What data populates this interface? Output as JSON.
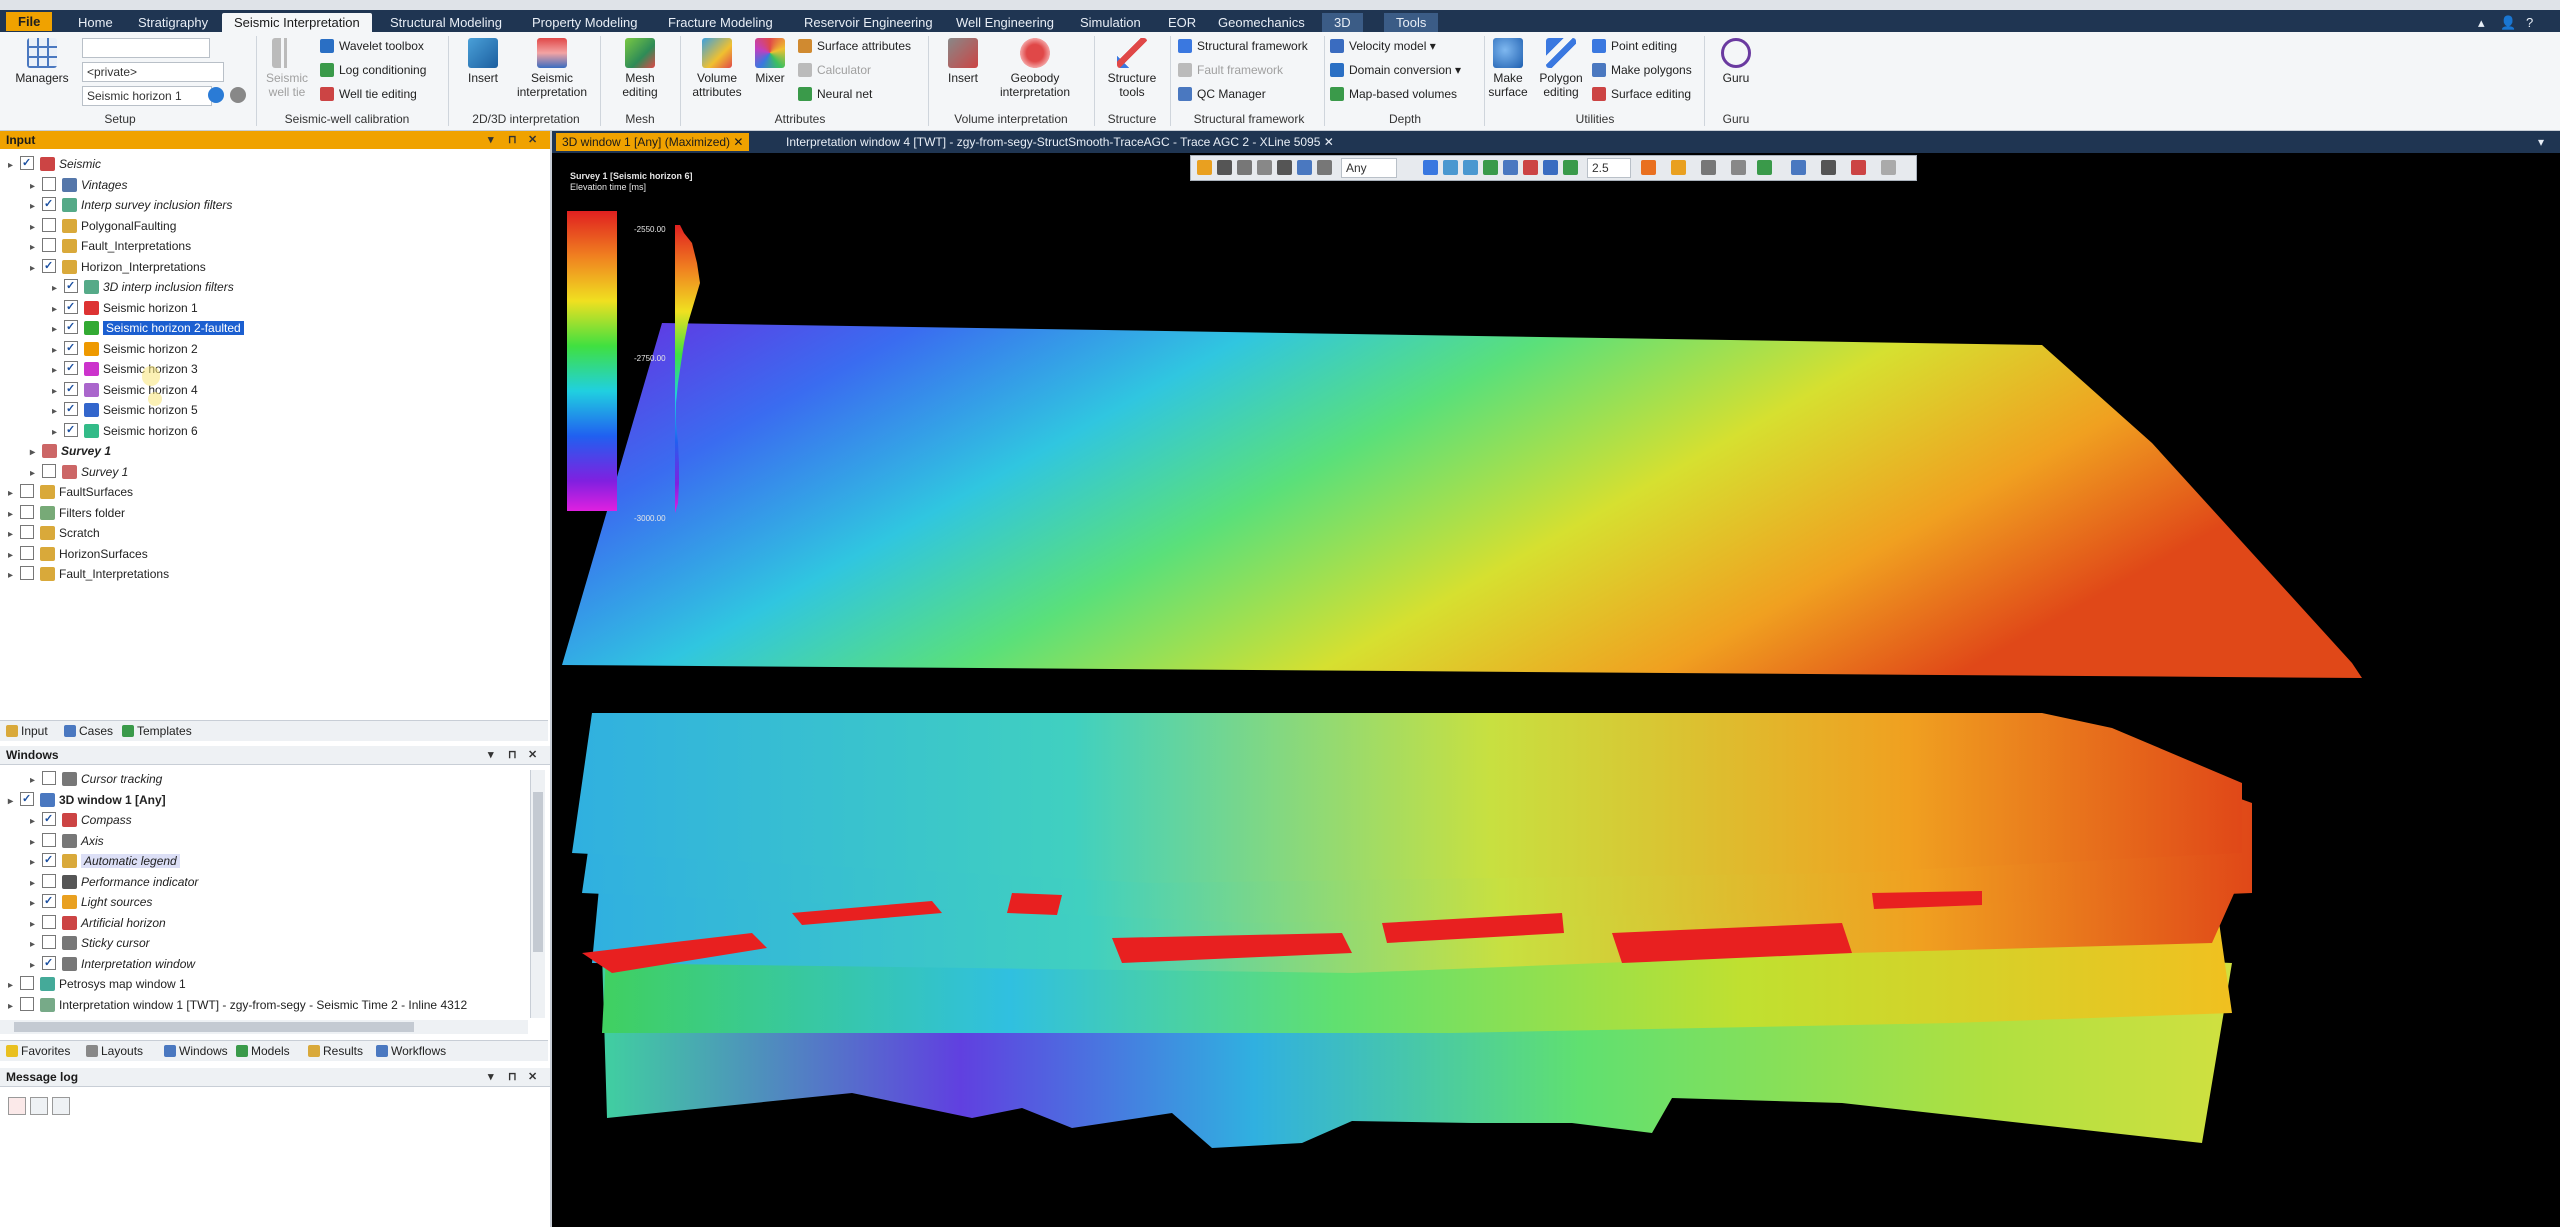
{
  "ribbon_tabs": [
    "File",
    "Home",
    "Stratigraphy",
    "Seismic Interpretation",
    "Structural Modeling",
    "Property Modeling",
    "Fracture Modeling",
    "Reservoir Engineering",
    "Well Engineering",
    "Simulation",
    "EOR",
    "Geomechanics",
    "3D",
    "Tools"
  ],
  "ribbon": {
    "setup": {
      "managers": "Managers",
      "private_combo": "<private>",
      "horizon_combo": "Seismic horizon 1",
      "label": "Setup"
    },
    "well_cal": {
      "seismic_well_tie": "Seismic well tie",
      "wavelet": "Wavelet toolbox",
      "log_cond": "Log conditioning",
      "well_tie_edit": "Well tie editing",
      "label": "Seismic-well calibration"
    },
    "interp2d3d": {
      "insert": "Insert",
      "seismic_interp": "Seismic interpretation",
      "label": "2D/3D interpretation"
    },
    "mesh": {
      "mesh_editing": "Mesh editing",
      "label": "Mesh"
    },
    "attributes": {
      "volume_attr": "Volume attributes",
      "mixer": "Mixer",
      "surface_attr": "Surface attributes",
      "calculator": "Calculator",
      "neural_net": "Neural net",
      "label": "Attributes"
    },
    "vol_interp": {
      "insert": "Insert",
      "geobody": "Geobody interpretation",
      "label": "Volume interpretation"
    },
    "structure": {
      "structure_tools": "Structure tools",
      "label": "Structure"
    },
    "struct_fw": {
      "structural_framework": "Structural framework",
      "fault_framework": "Fault framework",
      "qc_manager": "QC Manager",
      "label": "Structural framework"
    },
    "depth": {
      "velocity_model": "Velocity model",
      "domain_conversion": "Domain conversion",
      "map_based": "Map-based volumes",
      "label": "Depth"
    },
    "utilities": {
      "make_surface": "Make surface",
      "polygon_editing": "Polygon editing",
      "point_editing": "Point editing",
      "make_polygons": "Make polygons",
      "surface_editing": "Surface editing",
      "label": "Utilities"
    },
    "guru": {
      "guru": "Guru",
      "label": "Guru"
    }
  },
  "input_panel": {
    "title": "Input",
    "tree": [
      {
        "label": "Seismic",
        "indent": 0,
        "checked": true,
        "italic": true,
        "icon": "seismic-icon",
        "color": "#c44"
      },
      {
        "label": "Vintages",
        "indent": 1,
        "checked": false,
        "italic": true,
        "icon": "vintage-icon",
        "color": "#57a"
      },
      {
        "label": "Interp survey inclusion filters",
        "indent": 1,
        "checked": true,
        "italic": true,
        "icon": "filter-icon",
        "color": "#5a8"
      },
      {
        "label": "PolygonalFaulting",
        "indent": 1,
        "checked": false,
        "italic": false,
        "icon": "folder-icon",
        "color": "#d9a93a"
      },
      {
        "label": "Fault_Interpretations",
        "indent": 1,
        "checked": false,
        "italic": false,
        "icon": "folder-icon",
        "color": "#d9a93a"
      },
      {
        "label": "Horizon_Interpretations",
        "indent": 1,
        "checked": true,
        "italic": false,
        "icon": "folder-icon",
        "color": "#d9a93a"
      },
      {
        "label": "3D interp inclusion filters",
        "indent": 2,
        "checked": true,
        "italic": true,
        "icon": "filter-icon",
        "color": "#5a8"
      },
      {
        "label": "Seismic horizon 1",
        "indent": 2,
        "checked": true,
        "italic": false,
        "icon": "horizon-icon",
        "color": "#d33"
      },
      {
        "label": "Seismic horizon 2-faulted",
        "indent": 2,
        "checked": true,
        "italic": false,
        "icon": "horizon-icon",
        "color": "#3a3",
        "selected": true
      },
      {
        "label": "Seismic horizon 2",
        "indent": 2,
        "checked": true,
        "italic": false,
        "icon": "horizon-icon",
        "color": "#e90"
      },
      {
        "label": "Seismic horizon 3",
        "indent": 2,
        "checked": true,
        "italic": false,
        "icon": "horizon-icon",
        "color": "#c3c"
      },
      {
        "label": "Seismic horizon 4",
        "indent": 2,
        "checked": true,
        "italic": false,
        "icon": "horizon-icon",
        "color": "#a6c"
      },
      {
        "label": "Seismic horizon 5",
        "indent": 2,
        "checked": true,
        "italic": false,
        "icon": "horizon-icon",
        "color": "#36c"
      },
      {
        "label": "Seismic horizon 6",
        "indent": 2,
        "checked": true,
        "italic": false,
        "icon": "horizon-icon",
        "color": "#3b8"
      },
      {
        "label": "Survey 1",
        "indent": 1,
        "checked": null,
        "italic": true,
        "bold": true,
        "icon": "survey-icon",
        "color": "#c66"
      },
      {
        "label": "Survey 1",
        "indent": 1,
        "checked": false,
        "italic": true,
        "icon": "survey-icon",
        "color": "#c66"
      },
      {
        "label": "FaultSurfaces",
        "indent": 0,
        "checked": false,
        "italic": false,
        "icon": "folder-icon",
        "color": "#d9a93a"
      },
      {
        "label": "Filters folder",
        "indent": 0,
        "checked": false,
        "italic": false,
        "icon": "folder-icon",
        "color": "#7a7"
      },
      {
        "label": "Scratch",
        "indent": 0,
        "checked": false,
        "italic": false,
        "icon": "folder-icon",
        "color": "#d9a93a"
      },
      {
        "label": "HorizonSurfaces",
        "indent": 0,
        "checked": false,
        "italic": false,
        "icon": "folder-icon",
        "color": "#d9a93a"
      },
      {
        "label": "Fault_Interpretations",
        "indent": 0,
        "checked": false,
        "italic": false,
        "icon": "folder-icon",
        "color": "#d9a93a"
      }
    ],
    "tabs": [
      "Input",
      "Cases",
      "Templates"
    ]
  },
  "windows_panel": {
    "title": "Windows",
    "tree": [
      {
        "label": "Cursor tracking",
        "indent": 1,
        "checked": false,
        "italic": true,
        "icon": "cursor-icon",
        "color": "#777"
      },
      {
        "label": "3D window 1 [Any]",
        "indent": 0,
        "checked": true,
        "italic": false,
        "bold": true,
        "icon": "window3d-icon",
        "color": "#4a78c0"
      },
      {
        "label": "Compass",
        "indent": 1,
        "checked": true,
        "italic": true,
        "icon": "compass-icon",
        "color": "#c44"
      },
      {
        "label": "Axis",
        "indent": 1,
        "checked": false,
        "italic": true,
        "icon": "axis-icon",
        "color": "#777"
      },
      {
        "label": "Automatic legend",
        "indent": 1,
        "checked": true,
        "italic": true,
        "icon": "legend-icon",
        "color": "#d9a93a",
        "highlight": true
      },
      {
        "label": "Performance indicator",
        "indent": 1,
        "checked": false,
        "italic": true,
        "icon": "performance-icon",
        "color": "#555"
      },
      {
        "label": "Light sources",
        "indent": 1,
        "checked": true,
        "italic": true,
        "icon": "light-icon",
        "color": "#e9a020"
      },
      {
        "label": "Artificial horizon",
        "indent": 1,
        "checked": false,
        "italic": true,
        "icon": "horizon-ring-icon",
        "color": "#c44"
      },
      {
        "label": "Sticky cursor",
        "indent": 1,
        "checked": false,
        "italic": true,
        "icon": "cursor-icon",
        "color": "#777"
      },
      {
        "label": "Interpretation window",
        "indent": 1,
        "checked": true,
        "italic": true,
        "icon": "interp-window-icon",
        "color": "#777"
      },
      {
        "label": "Petrosys map window 1",
        "indent": 0,
        "checked": false,
        "italic": false,
        "icon": "map-window-icon",
        "color": "#4a9"
      },
      {
        "label": "Interpretation window 1 [TWT] - zgy-from-segy - Seismic Time 2 - Inline 4312",
        "indent": 0,
        "checked": false,
        "italic": false,
        "icon": "interp-window-icon",
        "color": "#7a8"
      }
    ],
    "tabs": [
      "Favorites",
      "Layouts",
      "Windows",
      "Models",
      "Results",
      "Workflows"
    ]
  },
  "message_log": {
    "title": "Message log"
  },
  "view_tabs": [
    {
      "label": "3D window 1 [Any] (Maximized)",
      "active": true
    },
    {
      "label": "Interpretation window 4 [TWT] - zgy-from-segy-StructSmooth-TraceAGC - Trace AGC 2 - XLine 5095",
      "active": false
    }
  ],
  "viewer_toolbar": {
    "domain": "Any",
    "zoom": "2.5"
  },
  "legend": {
    "title": "Survey 1 [Seismic horizon 6]",
    "subtitle": "Elevation time [ms]",
    "max": "-2550.00",
    "mid": "-2750.00",
    "min": "-3000.00"
  },
  "colors": {
    "ribbon_dark": "#1f3552",
    "accent_orange": "#f0a200",
    "selection_blue": "#1c5fd0",
    "viewport": "#000000"
  }
}
